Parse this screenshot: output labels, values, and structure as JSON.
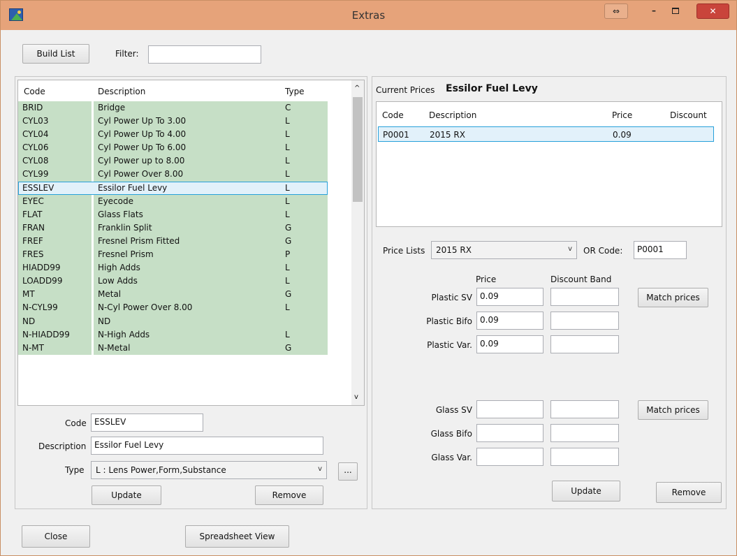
{
  "window": {
    "title": "Extras"
  },
  "toolbar": {
    "build_list": "Build List",
    "filter_label": "Filter:",
    "filter_value": ""
  },
  "list": {
    "columns": [
      "Code",
      "Description",
      "Type"
    ],
    "rows": [
      {
        "code": "BRID",
        "description": "Bridge",
        "type": "C"
      },
      {
        "code": "CYL03",
        "description": "Cyl Power Up To 3.00",
        "type": "L"
      },
      {
        "code": "CYL04",
        "description": "Cyl Power Up To 4.00",
        "type": "L"
      },
      {
        "code": "CYL06",
        "description": "Cyl Power Up To 6.00",
        "type": "L"
      },
      {
        "code": "CYL08",
        "description": "Cyl Power up to 8.00",
        "type": "L"
      },
      {
        "code": "CYL99",
        "description": "Cyl Power Over 8.00",
        "type": "L"
      },
      {
        "code": "ESSLEV",
        "description": "Essilor Fuel Levy",
        "type": "L"
      },
      {
        "code": "EYEC",
        "description": "Eyecode",
        "type": "L"
      },
      {
        "code": "FLAT",
        "description": "Glass Flats",
        "type": "L"
      },
      {
        "code": "FRAN",
        "description": "Franklin Split",
        "type": "G"
      },
      {
        "code": "FREF",
        "description": "Fresnel Prism Fitted",
        "type": "G"
      },
      {
        "code": "FRES",
        "description": "Fresnel Prism",
        "type": "P"
      },
      {
        "code": "HIADD99",
        "description": "High Adds",
        "type": "L"
      },
      {
        "code": "LOADD99",
        "description": "Low Adds",
        "type": "L"
      },
      {
        "code": "MT",
        "description": "Metal",
        "type": "G"
      },
      {
        "code": "N-CYL99",
        "description": "N-Cyl Power Over 8.00",
        "type": "L"
      },
      {
        "code": "ND",
        "description": "ND",
        "type": ""
      },
      {
        "code": "N-HIADD99",
        "description": "N-High Adds",
        "type": "L"
      },
      {
        "code": "N-MT",
        "description": "N-Metal",
        "type": "G"
      }
    ],
    "selected_index": 6
  },
  "detail": {
    "code_label": "Code",
    "code_value": "ESSLEV",
    "description_label": "Description",
    "description_value": "Essilor Fuel Levy",
    "type_label": "Type",
    "type_value": "L : Lens Power,Form,Substance",
    "ellipsis": "...",
    "update": "Update",
    "remove": "Remove"
  },
  "current_prices": {
    "label": "Current Prices",
    "name": "Essilor Fuel Levy",
    "columns": [
      "Code",
      "Description",
      "Price",
      "Discount"
    ],
    "rows": [
      {
        "code": "P0001",
        "description": "2015 RX",
        "price": "0.09",
        "discount": ""
      }
    ]
  },
  "price_lists": {
    "label": "Price Lists",
    "value": "2015 RX",
    "or_code_label": "OR Code:",
    "or_code_value": "P0001",
    "price_header": "Price",
    "discount_header": "Discount Band",
    "plastic": [
      {
        "label": "Plastic SV",
        "price": "0.09",
        "discount": ""
      },
      {
        "label": "Plastic Bifo",
        "price": "0.09",
        "discount": ""
      },
      {
        "label": "Plastic Var.",
        "price": "0.09",
        "discount": ""
      }
    ],
    "glass": [
      {
        "label": "Glass SV",
        "price": "",
        "discount": ""
      },
      {
        "label": "Glass Bifo",
        "price": "",
        "discount": ""
      },
      {
        "label": "Glass Var.",
        "price": "",
        "discount": ""
      }
    ],
    "match_prices": "Match prices",
    "update": "Update",
    "remove": "Remove"
  },
  "footer": {
    "close": "Close",
    "spreadsheet_view": "Spreadsheet View"
  }
}
